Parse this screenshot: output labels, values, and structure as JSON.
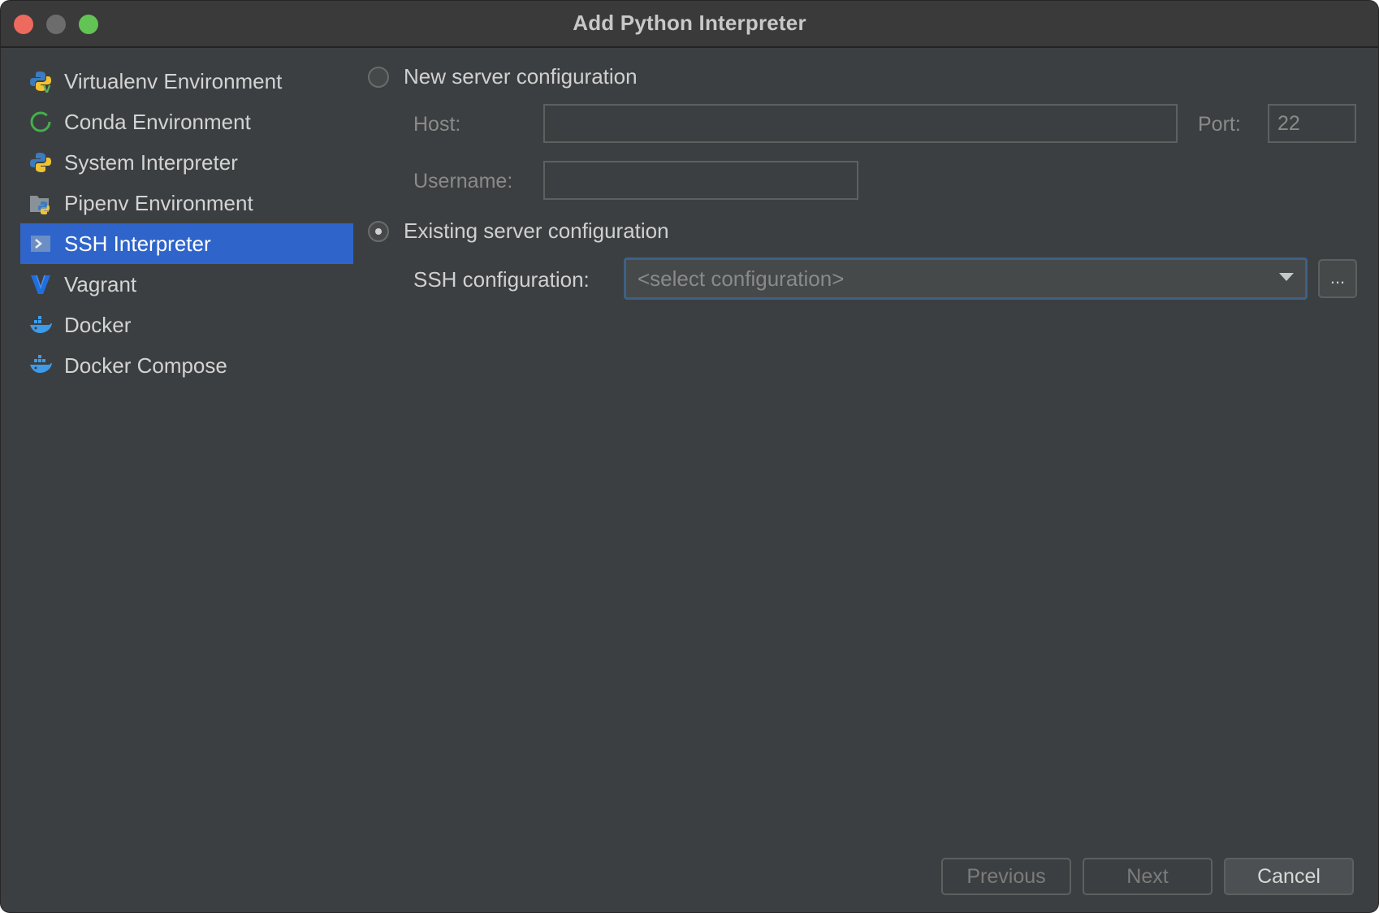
{
  "window": {
    "title": "Add Python Interpreter"
  },
  "sidebar": {
    "items": [
      {
        "label": "Virtualenv Environment",
        "icon": "python-virtualenv-icon",
        "selected": false
      },
      {
        "label": "Conda Environment",
        "icon": "conda-icon",
        "selected": false
      },
      {
        "label": "System Interpreter",
        "icon": "python-icon",
        "selected": false
      },
      {
        "label": "Pipenv Environment",
        "icon": "pipenv-icon",
        "selected": false
      },
      {
        "label": "SSH Interpreter",
        "icon": "ssh-terminal-icon",
        "selected": true
      },
      {
        "label": "Vagrant",
        "icon": "vagrant-icon",
        "selected": false
      },
      {
        "label": "Docker",
        "icon": "docker-icon",
        "selected": false
      },
      {
        "label": "Docker Compose",
        "icon": "docker-compose-icon",
        "selected": false
      }
    ]
  },
  "new_server": {
    "radio_label": "New server configuration",
    "selected": false,
    "host_label": "Host:",
    "host_value": "",
    "port_label": "Port:",
    "port_value": "22",
    "username_label": "Username:",
    "username_value": ""
  },
  "existing_server": {
    "radio_label": "Existing server configuration",
    "selected": true,
    "ssh_config_label": "SSH configuration:",
    "ssh_config_placeholder": "<select configuration>",
    "browse_label": "..."
  },
  "footer": {
    "previous_label": "Previous",
    "next_label": "Next",
    "cancel_label": "Cancel"
  },
  "colors": {
    "background": "#3c3f41",
    "selection": "#2f65ca",
    "focus_border": "#3d6185"
  }
}
